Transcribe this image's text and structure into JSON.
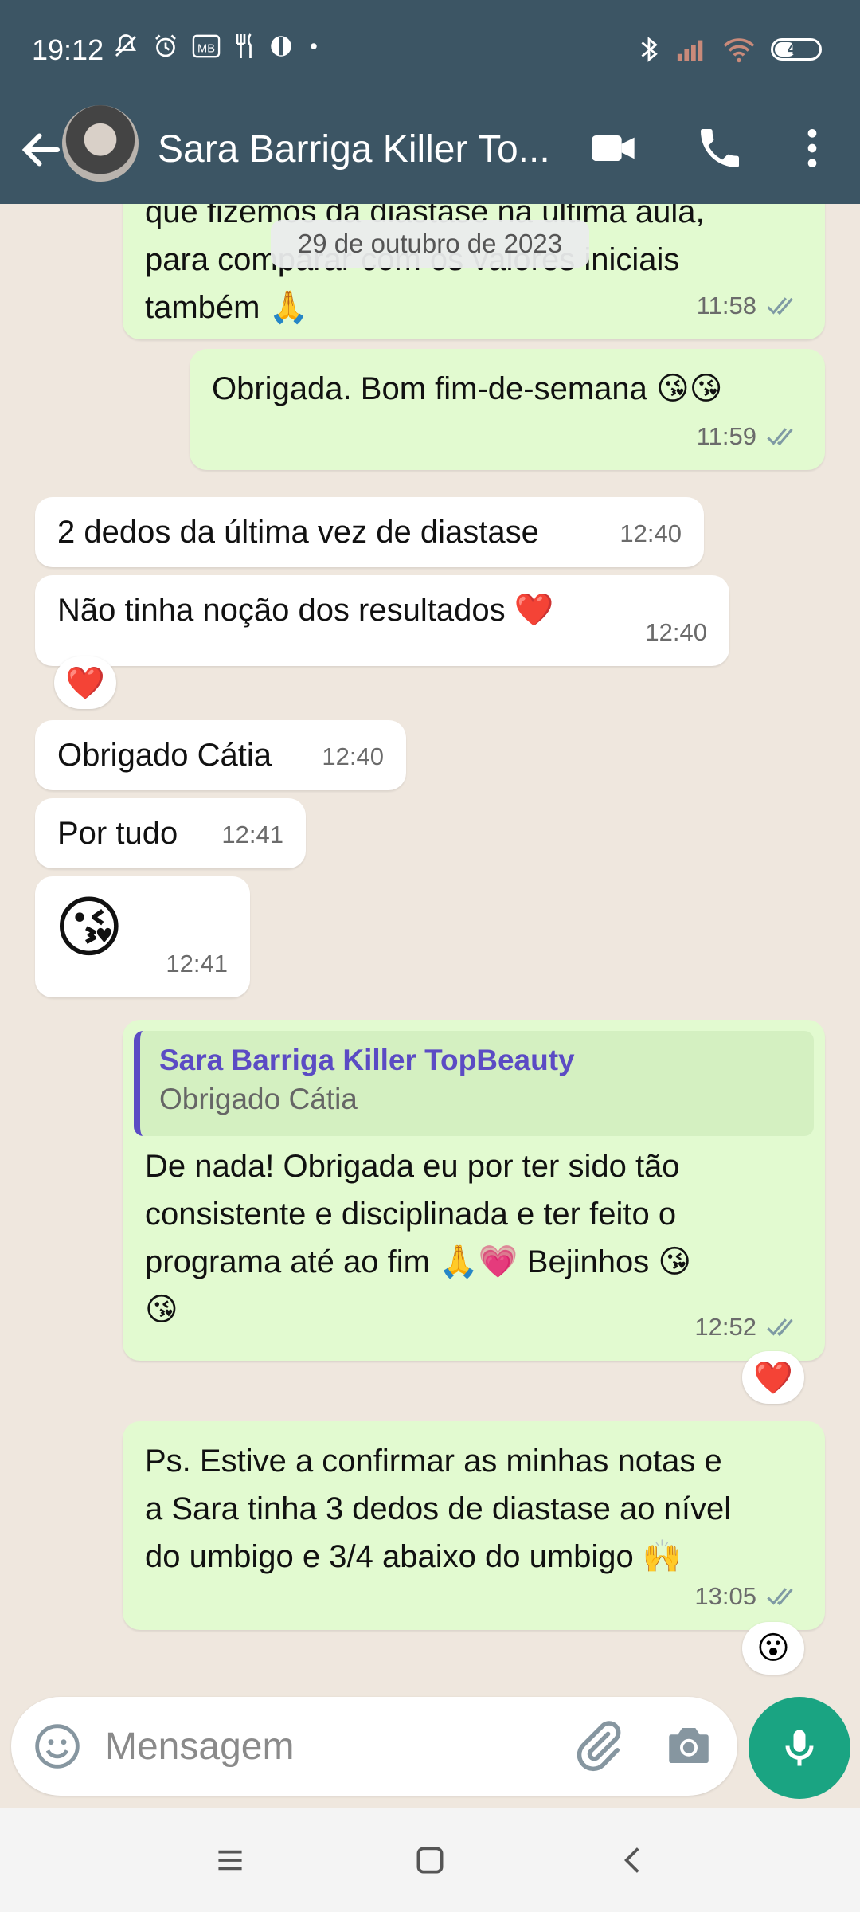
{
  "status_bar": {
    "time": "19:12",
    "left_icons": [
      "bell-off-icon",
      "alarm-icon",
      "mb-icon",
      "restaurant-icon",
      "app-icon",
      "dot"
    ],
    "battery": "45"
  },
  "header": {
    "contact_name": "Sara Barriga Killer To...",
    "icons": [
      "back-arrow-icon",
      "video-call-icon",
      "phone-icon",
      "more-options-icon"
    ]
  },
  "date_chip": "29 de outubro de 2023",
  "messages": [
    {
      "dir": "out",
      "lines": [
        "que fizemos da diastase na última aula,",
        "para comparar com os valores iniciais",
        "também 🙏"
      ],
      "time": "11:58",
      "ticks": true
    },
    {
      "dir": "out",
      "lines": [
        "Obrigada. Bom fim-de-semana 😘😘"
      ],
      "time": "11:59",
      "ticks": true
    },
    {
      "dir": "in",
      "lines": [
        "2 dedos da última vez de diastase"
      ],
      "time": "12:40"
    },
    {
      "dir": "in",
      "lines": [
        "Não tinha noção dos resultados ❤️"
      ],
      "time": "12:40",
      "reaction": "❤️"
    },
    {
      "dir": "in",
      "lines": [
        "Obrigado Cátia"
      ],
      "time": "12:40"
    },
    {
      "dir": "in",
      "lines": [
        "Por tudo"
      ],
      "time": "12:41"
    },
    {
      "dir": "in",
      "lines": [
        "😘"
      ],
      "time": "12:41"
    },
    {
      "dir": "out",
      "quote": {
        "author": "Sara Barriga Killer TopBeauty",
        "text": "Obrigado Cátia"
      },
      "lines": [
        "De nada! Obrigada eu por ter sido tão",
        "consistente e disciplinada e ter feito o",
        "programa até ao fim 🙏💗 Bejinhos 😘",
        "😘"
      ],
      "time": "12:52",
      "ticks": true,
      "reaction": "❤️"
    },
    {
      "dir": "out",
      "lines": [
        "Ps. Estive a confirmar as minhas notas e",
        "a Sara tinha 3 dedos de diastase ao nível",
        "do umbigo e 3/4 abaixo do umbigo 🙌"
      ],
      "time": "13:05",
      "ticks": true,
      "reaction": "😮"
    }
  ],
  "composer": {
    "placeholder": "Mensagem",
    "icons": [
      "emoji-icon",
      "attach-icon",
      "camera-icon",
      "mic-icon"
    ]
  },
  "nav": [
    "menu-icon",
    "home-icon",
    "back-icon"
  ],
  "colors": {
    "header": "#3c5564",
    "outgoing_bubble": "#e2fad0",
    "incoming_bubble": "#ffffff",
    "accent_green": "#1aa482",
    "quote_author": "#5b4bc4"
  }
}
